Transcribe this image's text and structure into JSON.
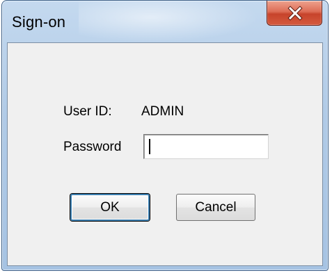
{
  "window": {
    "title": "Sign-on"
  },
  "form": {
    "userid_label": "User ID:",
    "userid_value": "ADMIN",
    "password_label": "Password",
    "password_value": "",
    "password_placeholder": ""
  },
  "buttons": {
    "ok_label": "OK",
    "cancel_label": "Cancel"
  },
  "icons": {
    "close": "close-icon"
  },
  "colors": {
    "title_bar": "#b1cbe7",
    "close_button": "#c7432b",
    "client_background": "#f0f0f0",
    "default_button_border": "#3c7fb1"
  }
}
